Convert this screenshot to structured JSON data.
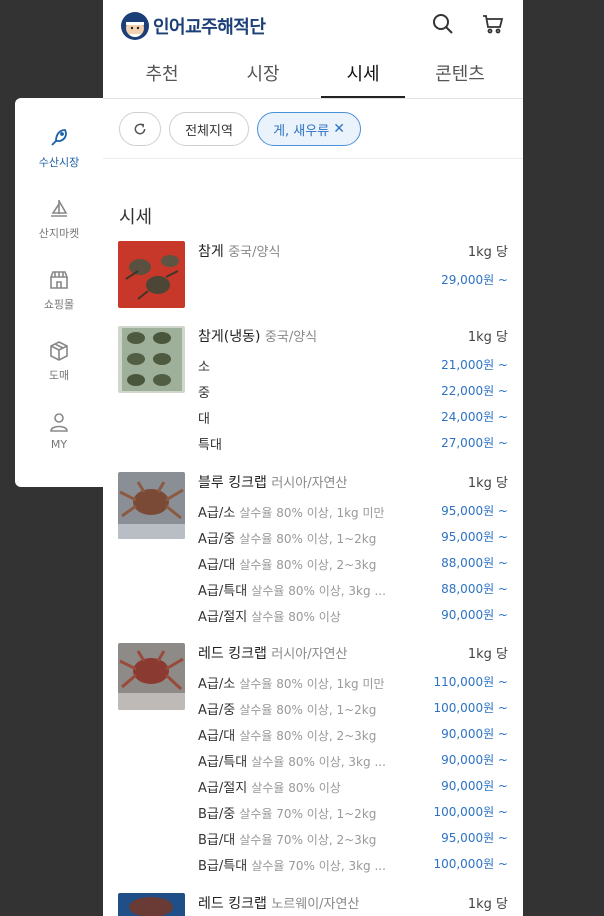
{
  "header": {
    "brand": "인어교주해적단"
  },
  "tabs": [
    "추천",
    "시장",
    "시세",
    "콘텐츠"
  ],
  "filters": {
    "region": "전체지역",
    "category": "게, 새우류"
  },
  "sidebar": [
    "수산시장",
    "산지마켓",
    "쇼핑몰",
    "도매",
    "MY"
  ],
  "section_title": "시세",
  "items": [
    {
      "name": "참게",
      "origin": "중국/양식",
      "unit": "1kg 당",
      "rows": [
        {
          "grade": "",
          "desc": "",
          "price": "29,000원 ~"
        }
      ]
    },
    {
      "name": "참게(냉동)",
      "origin": "중국/양식",
      "unit": "1kg 당",
      "rows": [
        {
          "grade": "소",
          "desc": "",
          "price": "21,000원 ~"
        },
        {
          "grade": "중",
          "desc": "",
          "price": "22,000원 ~"
        },
        {
          "grade": "대",
          "desc": "",
          "price": "24,000원 ~"
        },
        {
          "grade": "특대",
          "desc": "",
          "price": "27,000원 ~"
        }
      ]
    },
    {
      "name": "블루 킹크랩",
      "origin": "러시아/자연산",
      "unit": "1kg 당",
      "rows": [
        {
          "grade": "A급/소",
          "desc": "살수율 80% 이상, 1kg 미만",
          "price": "95,000원 ~"
        },
        {
          "grade": "A급/중",
          "desc": "살수율 80% 이상, 1~2kg",
          "price": "95,000원 ~"
        },
        {
          "grade": "A급/대",
          "desc": "살수율 80% 이상, 2~3kg",
          "price": "88,000원 ~"
        },
        {
          "grade": "A급/특대",
          "desc": "살수율 80% 이상, 3kg ...",
          "price": "88,000원 ~"
        },
        {
          "grade": "A급/절지",
          "desc": "살수율 80% 이상",
          "price": "90,000원 ~"
        }
      ]
    },
    {
      "name": "레드 킹크랩",
      "origin": "러시아/자연산",
      "unit": "1kg 당",
      "rows": [
        {
          "grade": "A급/소",
          "desc": "살수율 80% 이상, 1kg 미만",
          "price": "110,000원 ~"
        },
        {
          "grade": "A급/중",
          "desc": "살수율 80% 이상, 1~2kg",
          "price": "100,000원 ~"
        },
        {
          "grade": "A급/대",
          "desc": "살수율 80% 이상, 2~3kg",
          "price": "90,000원 ~"
        },
        {
          "grade": "A급/특대",
          "desc": "살수율 80% 이상, 3kg ...",
          "price": "90,000원 ~"
        },
        {
          "grade": "A급/절지",
          "desc": "살수율 80% 이상",
          "price": "90,000원 ~"
        },
        {
          "grade": "B급/중",
          "desc": "살수율 70% 이상, 1~2kg",
          "price": "100,000원 ~"
        },
        {
          "grade": "B급/대",
          "desc": "살수율 70% 이상, 2~3kg",
          "price": "95,000원 ~"
        },
        {
          "grade": "B급/특대",
          "desc": "살수율 70% 이상, 3kg ...",
          "price": "100,000원 ~"
        }
      ]
    },
    {
      "name": "레드 킹크랩",
      "origin": "노르웨이/자연산",
      "unit": "1kg 당",
      "rows": []
    }
  ]
}
